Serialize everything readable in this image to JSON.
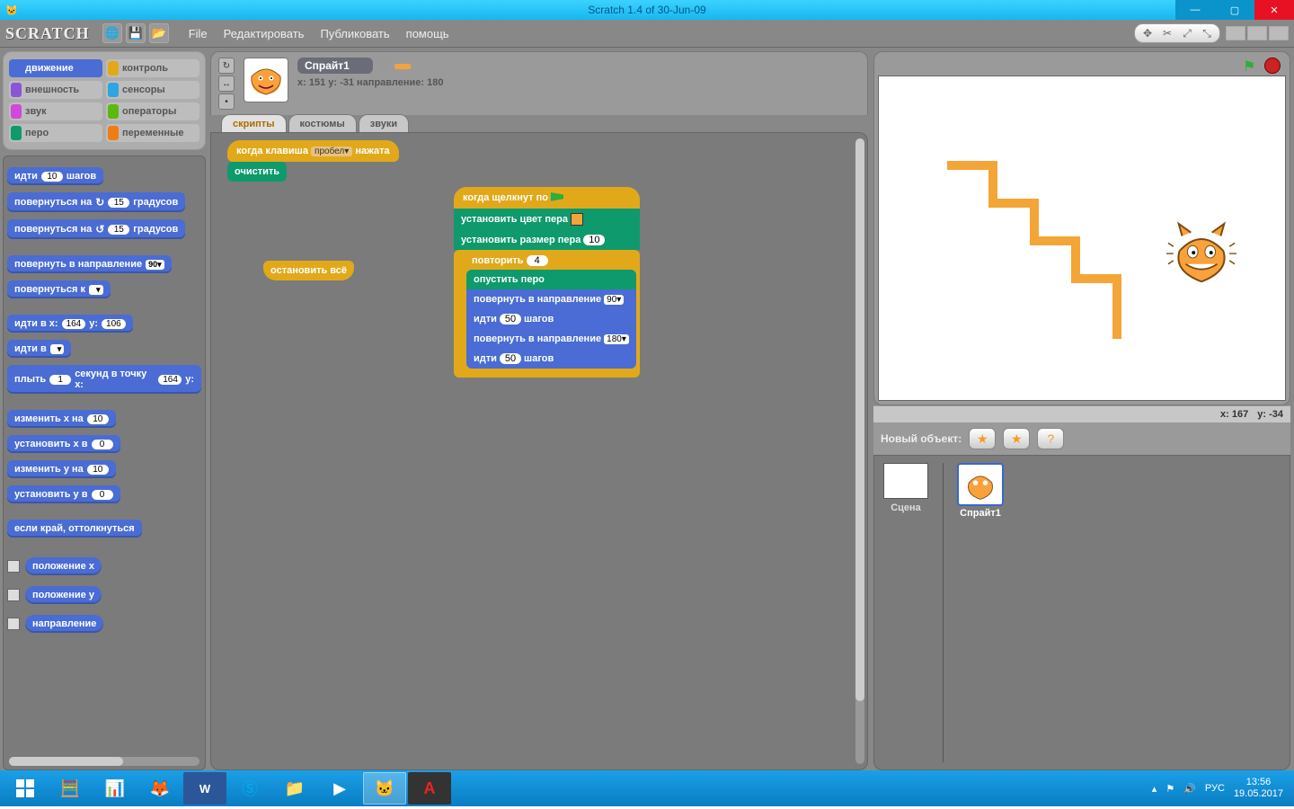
{
  "window": {
    "title": "Scratch 1.4 of 30-Jun-09"
  },
  "menu": {
    "file": "File",
    "edit": "Редактировать",
    "share": "Публиковать",
    "help": "помощь"
  },
  "categories": [
    {
      "label": "движение",
      "color": "#4a6cd4",
      "active": true
    },
    {
      "label": "контроль",
      "color": "#e1a91a"
    },
    {
      "label": "внешность",
      "color": "#8a55d7"
    },
    {
      "label": "сенсоры",
      "color": "#2ca5e2"
    },
    {
      "label": "звук",
      "color": "#cf4ad9"
    },
    {
      "label": "операторы",
      "color": "#5cb712"
    },
    {
      "label": "перо",
      "color": "#0e9a6c"
    },
    {
      "label": "переменные",
      "color": "#ee7d16"
    }
  ],
  "palette": {
    "move": {
      "pre": "идти",
      "n": "10",
      "post": "шагов"
    },
    "turn_cw": {
      "pre": "повернуться на",
      "n": "15",
      "post": "градусов"
    },
    "turn_ccw": {
      "pre": "повернуться на",
      "n": "15",
      "post": "градусов"
    },
    "point_dir": {
      "pre": "повернуть в направление",
      "n": "90"
    },
    "point_to": {
      "pre": "повернуться к"
    },
    "goto_xy": {
      "pre": "идти в x:",
      "x": "164",
      "mid": "y:",
      "y": "106"
    },
    "goto": {
      "pre": "идти в"
    },
    "glide": {
      "pre": "плыть",
      "sec": "1",
      "mid": "секунд в точку x:",
      "x": "164",
      "mid2": "y:"
    },
    "change_x": {
      "pre": "изменить x на",
      "n": "10"
    },
    "set_x": {
      "pre": "установить x в",
      "n": "0"
    },
    "change_y": {
      "pre": "изменить y на",
      "n": "10"
    },
    "set_y": {
      "pre": "установить y в",
      "n": "0"
    },
    "bounce": {
      "pre": "если край, оттолкнуться"
    },
    "rep_x": "положение x",
    "rep_y": "положение y",
    "rep_dir": "направление"
  },
  "sprite": {
    "name": "Спрайт1",
    "info": "x: 151  y: -31  направление: 180"
  },
  "tabs": {
    "scripts": "скрипты",
    "costumes": "костюмы",
    "sounds": "звуки"
  },
  "script1": {
    "hat": {
      "pre": "когда клавиша",
      "key": "пробел",
      "post": "нажата"
    },
    "clear": "очистить"
  },
  "script2": {
    "stop": "остановить всё"
  },
  "script3": {
    "hat": "когда щелкнут по",
    "set_color": "установить цвет пера",
    "set_size": {
      "pre": "установить размер пера",
      "n": "10"
    },
    "repeat": {
      "pre": "повторить",
      "n": "4"
    },
    "pendown": "опустить перо",
    "point1": {
      "pre": "повернуть в направление",
      "n": "90"
    },
    "move1": {
      "pre": "идти",
      "n": "50",
      "post": "шагов"
    },
    "point2": {
      "pre": "повернуть в направление",
      "n": "180"
    },
    "move2": {
      "pre": "идти",
      "n": "50",
      "post": "шагов"
    }
  },
  "stage": {
    "coord_x_label": "x:",
    "coord_x": "167",
    "coord_y_label": "y:",
    "coord_y": "-34"
  },
  "sprites": {
    "new_label": "Новый объект:",
    "stage_label": "Сцена",
    "sprite1": "Спрайт1"
  },
  "taskbar": {
    "lang": "РУС",
    "time": "13:56",
    "date": "19.05.2017"
  }
}
